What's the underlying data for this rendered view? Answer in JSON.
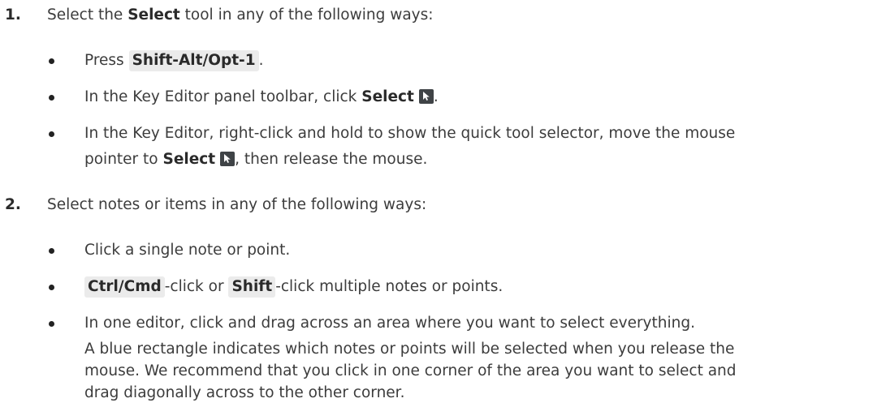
{
  "steps": [
    {
      "number": "1.",
      "intro": {
        "pre": "Select the ",
        "bold": "Select",
        "post": " tool in any of the following ways:"
      },
      "bullets": {
        "b1": {
          "pre": "Press ",
          "key": "Shift-Alt/Opt-1",
          "post": "."
        },
        "b2": {
          "pre": "In the Key Editor panel toolbar, click ",
          "bold": "Select",
          "post": "."
        },
        "b3": {
          "line1": "In the Key Editor, right-click and hold to show the quick tool selector, move the mouse",
          "pre": "pointer to ",
          "bold": "Select",
          "post": ", then release the mouse."
        }
      }
    },
    {
      "number": "2.",
      "intro": {
        "text": "Select notes or items in any of the following ways:"
      },
      "bullets": {
        "b1": {
          "text": "Click a single note or point."
        },
        "b2": {
          "key1": "Ctrl/Cmd",
          "mid": "-click or ",
          "key2": "Shift",
          "post": "-click multiple notes or points."
        },
        "b3": {
          "text": "In one editor, click and drag across an area where you want to select everything.",
          "para1": "A blue rectangle indicates which notes or points will be selected when you release the",
          "para2": "mouse. We recommend that you click in one corner of the area you want to select and",
          "para3": "drag diagonally across to the other corner."
        }
      }
    }
  ],
  "icons": {
    "select_tool": "select-arrow-icon"
  },
  "colors": {
    "text": "#3c3c3c",
    "key_bg": "#ebebeb",
    "icon_bg": "#3f4346"
  }
}
